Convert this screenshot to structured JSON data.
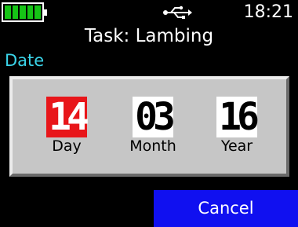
{
  "status_bar": {
    "battery_level": 1.0,
    "usb_icon": "usb-icon",
    "time": "18:21"
  },
  "header": {
    "title": "Task: Lambing"
  },
  "section": {
    "label": "Date"
  },
  "date_picker": {
    "day": {
      "value": "14",
      "label": "Day",
      "selected": true
    },
    "month": {
      "value": "03",
      "label": "Month",
      "selected": false
    },
    "year": {
      "value": "16",
      "label": "Year",
      "selected": false
    }
  },
  "footer": {
    "cancel_label": "Cancel"
  },
  "colors": {
    "battery": "#16c416",
    "section_label": "#3ad4e9",
    "panel": "#c6c6c6",
    "selected_field": "#e8161a",
    "cancel_button": "#1010f0"
  }
}
